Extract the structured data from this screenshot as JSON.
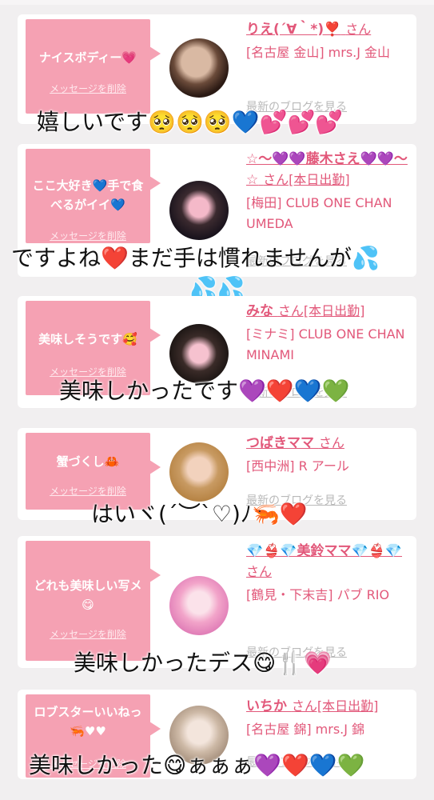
{
  "cards": [
    {
      "message": "ナイスボディー💗",
      "delete": "メッセージを削除",
      "name": "りえ(´∀｀*)❣️",
      "san": "さん",
      "shop": "[名古屋 金山] mrs.J 金山",
      "blog": "最新のブログを見る",
      "overlay": "嬉しいです🥺🥺🥺💙💕💕💕"
    },
    {
      "message": "ここ大好き💙手で食べるがイイ💙",
      "delete": "メッセージを削除",
      "name": "☆〜💜💜藤木さえ💜💜〜☆",
      "san": "さん[本日出勤]",
      "shop": "[梅田] CLUB ONE CHAN UMEDA",
      "blog": "最新のブログを見る",
      "overlay": "ですよね❤️まだ手は慣れませんが💦",
      "overlay2": "💦💦"
    },
    {
      "message": "美味しそうです🥰",
      "delete": "メッセージを削除",
      "name": "みな",
      "san": "さん[本日出勤]",
      "shop": "[ミナミ] CLUB ONE CHAN MINAMI",
      "blog": "最新のブログを見る",
      "overlay": "美味しかったです💜❤️💙💚"
    },
    {
      "message": "蟹づくし🦀",
      "delete": "メッセージを削除",
      "name": "つばきママ",
      "san": "さん",
      "shop": "[西中洲] R アール",
      "blog": "最新のブログを見る",
      "overlay": "はいヾ(´︶`♡)ﾉ🦐❤️"
    },
    {
      "message": "どれも美味しい写メ😋",
      "delete": "メッセージを削除",
      "name": "💎👙💎美鈴ママ💎👙💎",
      "san": "さん",
      "shop": "[鶴見・下末吉] パブ RIO",
      "blog": "最新のブログを見る",
      "overlay": "美味しかったデス😋🍴💗"
    },
    {
      "message": "ロブスターいいねっ🦐♥♥",
      "delete": "メッセージを削除",
      "name": "いちか",
      "san": "さん[本日出勤]",
      "shop": "[名古屋 錦] mrs.J 錦",
      "blog": "最新のブログを見る",
      "overlay": "美味しかった😋ぁぁぁ💜❤️💙💚"
    }
  ],
  "colors": {
    "bubble": "#f5a1b3",
    "accent": "#e2587a",
    "background": "#f1eff0"
  }
}
